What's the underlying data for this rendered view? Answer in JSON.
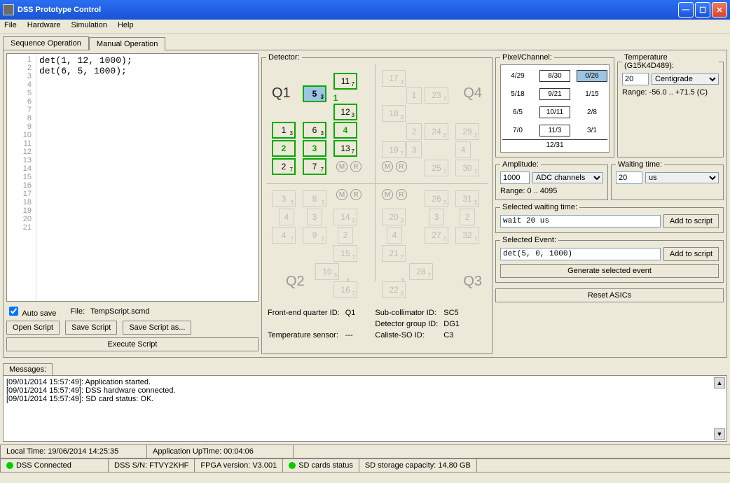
{
  "window": {
    "title": "DSS Prototype Control"
  },
  "menu": {
    "file": "File",
    "hardware": "Hardware",
    "simulation": "Simulation",
    "help": "Help"
  },
  "tabs": {
    "seq": "Sequence Operation",
    "manual": "Manual Operation"
  },
  "editor": {
    "lines": [
      "1",
      "2",
      "3",
      "4",
      "5",
      "6",
      "7",
      "8",
      "9",
      "10",
      "11",
      "12",
      "13",
      "14",
      "15",
      "16",
      "17",
      "18",
      "19",
      "20",
      "21"
    ],
    "code": "det(1, 12, 1000);\ndet(6, 5, 1000);",
    "autosave_label": "Auto save",
    "file_label": "File:",
    "file_name": "TempScript.scmd",
    "open": "Open Script",
    "save": "Save Script",
    "saveas": "Save Script as...",
    "execute": "Execute Script"
  },
  "detector": {
    "legend": "Detector:",
    "Q1": "Q1",
    "Q2": "Q2",
    "Q3": "Q3",
    "Q4": "Q4",
    "info": {
      "feq_label": "Front-end quarter ID:",
      "feq": "Q1",
      "sub_label": "Sub-collimator ID:",
      "sub": "SC5",
      "dg_label": "Detector group ID:",
      "dg": "DG1",
      "temp_label": "Temperature sensor:",
      "temp": "---",
      "cal_label": "Caliste-SO ID:",
      "cal": "C3"
    }
  },
  "pixel": {
    "legend": "Pixel/Channel:",
    "rows": [
      {
        "l": "4/29",
        "m": "8/30",
        "r": "0/26"
      },
      {
        "l": "5/18",
        "m": "9/21",
        "r": "1/15"
      },
      {
        "l": "6/5",
        "m": "10/11",
        "r": "2/8"
      },
      {
        "l": "7/0",
        "m": "11/3",
        "r": "3/1"
      }
    ],
    "bottom": "12/31"
  },
  "temperature": {
    "legend": "Temperature (G15K4D489):",
    "value": "20",
    "unit": "Centigrade",
    "range": "Range: -56.0 .. +71.5 (C)"
  },
  "amplitude": {
    "legend": "Amplitude:",
    "value": "1000",
    "unit": "ADC channels",
    "range": "Range: 0 .. 4095"
  },
  "waiting": {
    "legend": "Waiting time:",
    "value": "20",
    "unit": "us"
  },
  "sel_wait": {
    "legend": "Selected waiting time:",
    "value": "wait 20 us",
    "btn": "Add to script"
  },
  "sel_event": {
    "legend": "Selected Event:",
    "value": "det(5, 0, 1000)",
    "btn": "Add to script",
    "gen": "Generate selected event"
  },
  "reset": "Reset ASICs",
  "messages": {
    "tab": "Messages:",
    "lines": [
      "[09/01/2014 15:57:49]: Application started.",
      "[09/01/2014 15:57:49]: DSS hardware connected.",
      "[09/01/2014 15:57:49]: SD card status: OK."
    ]
  },
  "status1": {
    "local": "Local Time: 19/06/2014 14:25:35",
    "uptime": "Application UpTime: 00:04:06"
  },
  "status2": {
    "conn": "DSS Connected",
    "sn": "DSS S/N: FTVY2KHF",
    "fpga": "FPGA version: V3.001",
    "sd": "SD cards status",
    "cap": "SD storage capacity: 14,80 GB"
  }
}
